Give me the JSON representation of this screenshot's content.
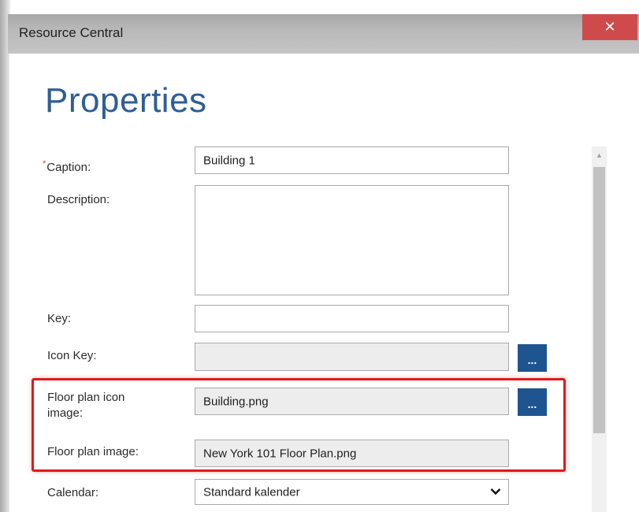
{
  "window": {
    "title": "Resource Central",
    "close_glyph": "✕"
  },
  "page": {
    "heading": "Properties"
  },
  "form": {
    "caption": {
      "required_mark": "*",
      "label": "Caption:",
      "value": "Building 1"
    },
    "description": {
      "label": "Description:",
      "value": ""
    },
    "key": {
      "label": "Key:",
      "value": ""
    },
    "icon_key": {
      "label": "Icon Key:",
      "value": "",
      "browse_label": "..."
    },
    "floor_plan_icon_image": {
      "label_line1": "Floor plan icon",
      "label_line2": "image:",
      "value": "Building.png",
      "browse_label": "..."
    },
    "floor_plan_image": {
      "label": "Floor plan image:",
      "value": "New York 101 Floor Plan.png"
    },
    "calendar": {
      "label": "Calendar:",
      "value": "Standard kalender"
    }
  },
  "colors": {
    "accent": "#2f5e93",
    "button": "#1e5591",
    "close": "#cf4b4b",
    "highlight": "#e0191b"
  },
  "icons": {
    "close": "close-icon",
    "dropdown": "chevron-down-icon",
    "scroll_up": "scroll-up-arrow-icon"
  }
}
